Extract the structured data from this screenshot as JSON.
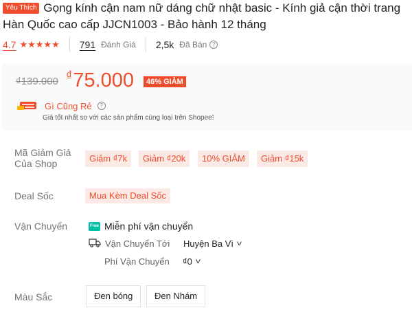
{
  "product": {
    "badge": "Yêu Thích",
    "title": "Gọng kính cận nam nữ dáng chữ nhật basic - Kính giả cận thời trang Hàn Quốc cao cấp JJCN1003 - Bảo hành 12 tháng"
  },
  "stats": {
    "rating": "4.7",
    "stars": "★★★★★",
    "reviews_count": "791",
    "reviews_label": "Đánh Giá",
    "sold_count": "2,5k",
    "sold_label": "Đã Bán",
    "help_icon": "question-circle-icon"
  },
  "price": {
    "old": "₫139.000",
    "currency": "₫",
    "current": "75.000",
    "discount": "46% GIẢM",
    "cheap_title": "Gì Cũng Rẻ",
    "cheap_subtitle": "Giá tốt nhất so với các sản phẩm cùng loại trên Shopee!"
  },
  "vouchers": {
    "label": "Mã Giảm Giá Của Shop",
    "items": [
      "Giảm ₫7k",
      "Giảm ₫20k",
      "10% GIẢM",
      "Giảm ₫15k"
    ]
  },
  "deal": {
    "label": "Deal Sốc",
    "tag": "Mua Kèm Deal Sốc"
  },
  "shipping": {
    "label": "Vận Chuyển",
    "free_icon_text": "Free",
    "free_text": "Miễn phí vận chuyển",
    "to_label": "Vận Chuyển Tới",
    "to_value": "Huyện Ba Vì",
    "fee_label": "Phí Vận Chuyển",
    "fee_value": "₫0"
  },
  "color": {
    "label": "Màu Sắc",
    "options": [
      "Đen bóng",
      "Đen Nhám"
    ]
  },
  "colors": {
    "accent": "#ee4d2d",
    "accent_bg": "#fbe9e5",
    "free_ship": "#00bfa5"
  }
}
